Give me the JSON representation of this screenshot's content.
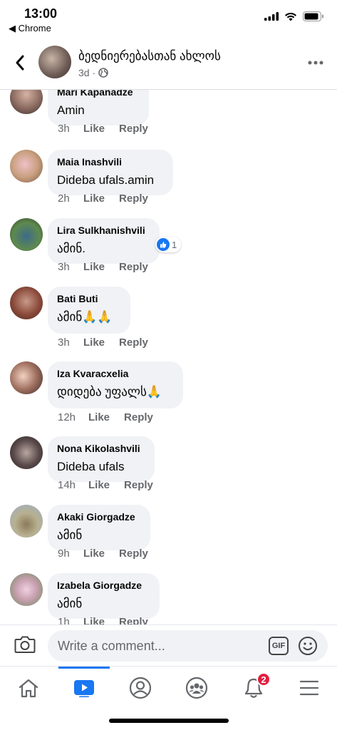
{
  "status_bar": {
    "time": "13:00",
    "back_app": "◀ Chrome"
  },
  "header": {
    "title": "ბედნიერებასთან ახლოს",
    "subtitle": "3d ·"
  },
  "comments": [
    {
      "name": "Mari Kapanadze",
      "text": "Amin",
      "time": "3h",
      "like": "Like",
      "reply": "Reply"
    },
    {
      "name": "Maia Inashvili",
      "text": "Dideba ufals.amin",
      "time": "2h",
      "like": "Like",
      "reply": "Reply"
    },
    {
      "name": "Lira Sulkhanishvili",
      "text": "ამინ.",
      "time": "3h",
      "like": "Like",
      "reply": "Reply",
      "reaction_count": "1"
    },
    {
      "name": "Bati Buti",
      "text": "ამინ🙏🙏",
      "time": "3h",
      "like": "Like",
      "reply": "Reply"
    },
    {
      "name": "Iza Kvaracxelia",
      "text": "დიდება უფალს🙏",
      "time": "12h",
      "like": "Like",
      "reply": "Reply"
    },
    {
      "name": "Nona Kikolashvili",
      "text": "Dideba ufals",
      "time": "14h",
      "like": "Like",
      "reply": "Reply"
    },
    {
      "name": "Akaki Giorgadze",
      "text": "ამინ",
      "time": "9h",
      "like": "Like",
      "reply": "Reply"
    },
    {
      "name": "Izabela Giorgadze",
      "text": "ამინ",
      "time": "1h",
      "like": "Like",
      "reply": "Reply"
    }
  ],
  "composer": {
    "placeholder": "Write a comment...",
    "gif_label": "GIF"
  },
  "bottom_nav": {
    "notifications_badge": "2"
  },
  "colors": {
    "accent": "#1877f2",
    "bubble": "#f0f2f5",
    "badge": "#e41e3f"
  }
}
